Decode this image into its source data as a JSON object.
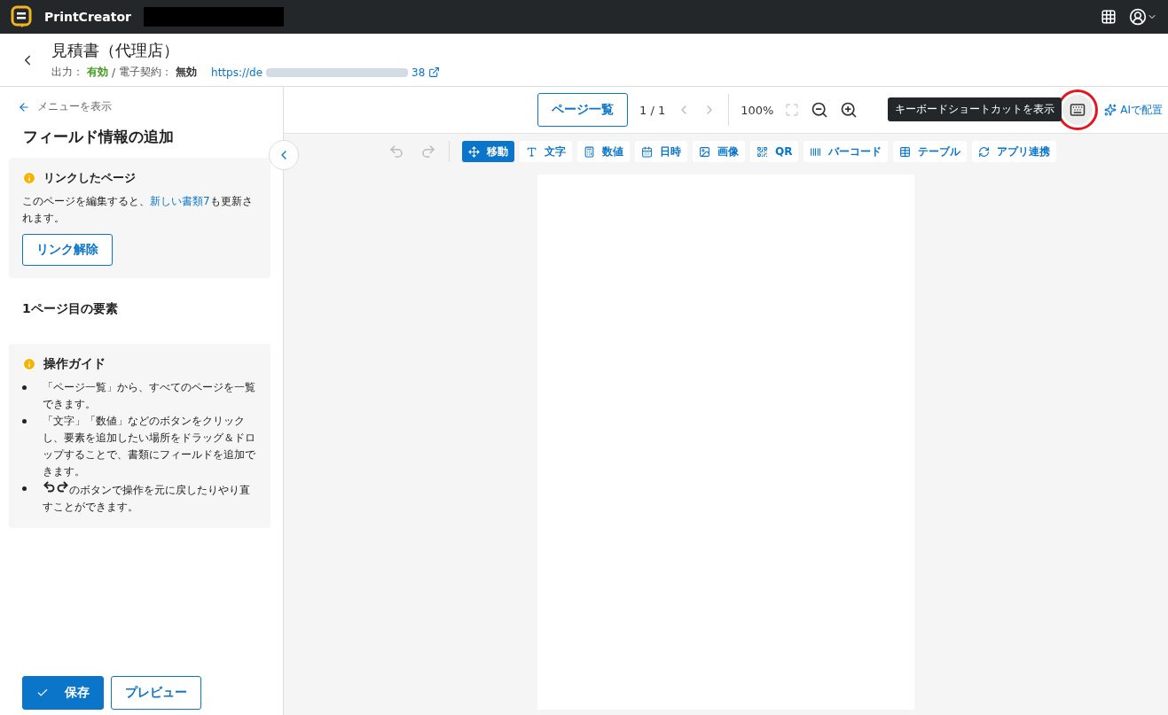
{
  "app_bar": {
    "app_name": "PrintCreator"
  },
  "header": {
    "title": "見積書（代理店）",
    "output_label": "出力：",
    "output_value": "有効",
    "separator": "/",
    "esign_label": "電子契約：",
    "esign_value": "無効",
    "url_start": "https://de",
    "url_end": "38"
  },
  "sidebar": {
    "menu_link": "メニューを表示",
    "title": "フィールド情報の追加",
    "linked_notice": {
      "title": "リンクしたページ",
      "text_before": "このページを編集すると、",
      "link": "新しい書類7",
      "text_after": "も更新されます。",
      "button": "リンク解除"
    },
    "elements_heading": "1ページ目の要素",
    "guide": {
      "title": "操作ガイド",
      "items": [
        {
          "kind": "text",
          "text": "「ページ一覧」から、すべてのページを一覧できます。"
        },
        {
          "kind": "text",
          "text": "「文字」「数値」などのボタンをクリックし、要素を追加したい場所をドラッグ＆ドロップすることで、書類にフィールドを追加できます。"
        },
        {
          "kind": "undo-redo",
          "text": "のボタンで操作を元に戻したりやり直すことができます。"
        }
      ]
    },
    "buttons": [
      {
        "kind": "primary",
        "label": "保存"
      },
      {
        "kind": "secondary",
        "label": "プレビュー"
      }
    ]
  },
  "top_toolbar": {
    "page_list_button": "ページ一覧",
    "page_indicator": "1 / 1",
    "zoom": "100%",
    "keyboard_button_highlighted": true,
    "tooltip": "キーボードショートカットを表示",
    "ai_button": "AIで配置"
  },
  "tools": [
    {
      "label": "移動",
      "selected": true
    },
    {
      "label": "文字",
      "selected": false
    },
    {
      "label": "数値",
      "selected": false
    },
    {
      "label": "日時",
      "selected": false
    },
    {
      "label": "画像",
      "selected": false
    },
    {
      "label": "QR",
      "selected": false
    },
    {
      "label": "バーコード",
      "selected": false
    },
    {
      "label": "テーブル",
      "selected": false
    },
    {
      "label": "アプリ連携",
      "selected": false
    }
  ]
}
